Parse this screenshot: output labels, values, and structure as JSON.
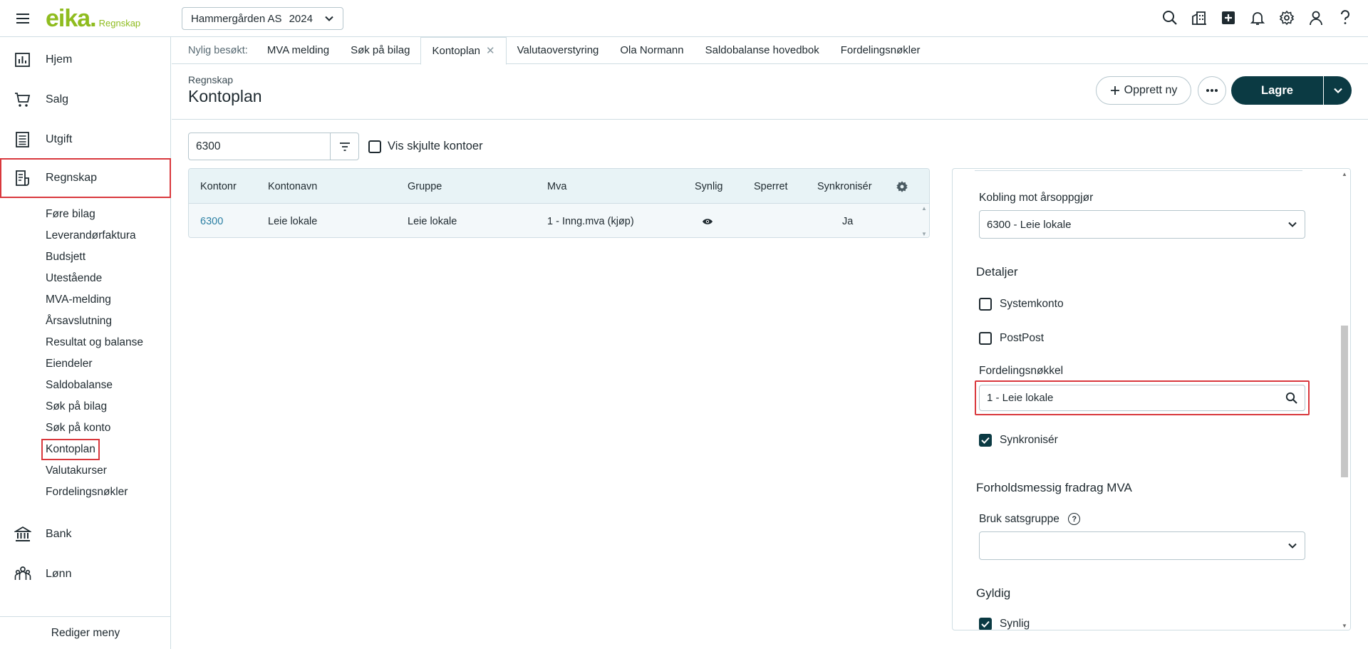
{
  "app": {
    "logo_word": "eika.",
    "logo_sub": "Regnskap",
    "company": "Hammergården AS",
    "year": "2024",
    "header_icons": [
      "search-icon",
      "building-icon",
      "plus-square-icon",
      "bell-icon",
      "gear-icon",
      "user-icon",
      "help-icon"
    ]
  },
  "sidebar": {
    "main": [
      {
        "label": "Hjem",
        "icon": "chart-icon"
      },
      {
        "label": "Salg",
        "icon": "cart-icon"
      },
      {
        "label": "Utgift",
        "icon": "list-icon"
      },
      {
        "label": "Regnskap",
        "icon": "ledger-icon"
      },
      {
        "label": "Bank",
        "icon": "bank-icon"
      },
      {
        "label": "Lønn",
        "icon": "people-icon"
      }
    ],
    "sub": [
      "Føre bilag",
      "Leverandørfaktura",
      "Budsjett",
      "Utestående",
      "MVA-melding",
      "Årsavslutning",
      "Resultat og balanse",
      "Eiendeler",
      "Saldobalanse",
      "Søk på bilag",
      "Søk på konto",
      "Kontoplan",
      "Valutakurser",
      "Fordelingsnøkler"
    ],
    "edit_menu": "Rediger meny"
  },
  "tabs": {
    "recent_label": "Nylig besøkt:",
    "items": [
      "MVA melding",
      "Søk på bilag",
      "Kontoplan",
      "Valutaoverstyring",
      "Ola Normann",
      "Saldobalanse hovedbok",
      "Fordelingsnøkler"
    ]
  },
  "page": {
    "breadcrumb": "Regnskap",
    "title": "Kontoplan",
    "new_button": "Opprett ny",
    "save_button": "Lagre"
  },
  "toolbar": {
    "search_value": "6300",
    "show_hidden_label": "Vis skjulte kontoer"
  },
  "table": {
    "columns": [
      "Kontonr",
      "Kontonavn",
      "Gruppe",
      "Mva",
      "Synlig",
      "Sperret",
      "Synkronisér"
    ],
    "rows": [
      {
        "kontonr": "6300",
        "kontonavn": "Leie lokale",
        "gruppe": "Leie lokale",
        "mva": "1 - Inng.mva (kjøp)",
        "synlig": "eye-icon",
        "sperret": "",
        "synkroniser": "Ja"
      }
    ]
  },
  "details": {
    "kobling_label": "Kobling mot årsoppgjør",
    "kobling_value": "6300 - Leie lokale",
    "detaljer_heading": "Detaljer",
    "systemkonto_label": "Systemkonto",
    "postpost_label": "PostPost",
    "fordelingsnokkel_label": "Fordelingsnøkkel",
    "fordelingsnokkel_value": "1 - Leie lokale",
    "synkroniser_label": "Synkronisér",
    "fradrag_heading": "Forholdsmessig fradrag MVA",
    "satsgruppe_label": "Bruk satsgruppe",
    "satsgruppe_value": "",
    "gyldig_heading": "Gyldig",
    "synlig_label": "Synlig"
  },
  "colors": {
    "brand": "#8fbc1f",
    "primary": "#0b3a43",
    "highlight": "#d9383d",
    "link": "#2a7fa3"
  }
}
